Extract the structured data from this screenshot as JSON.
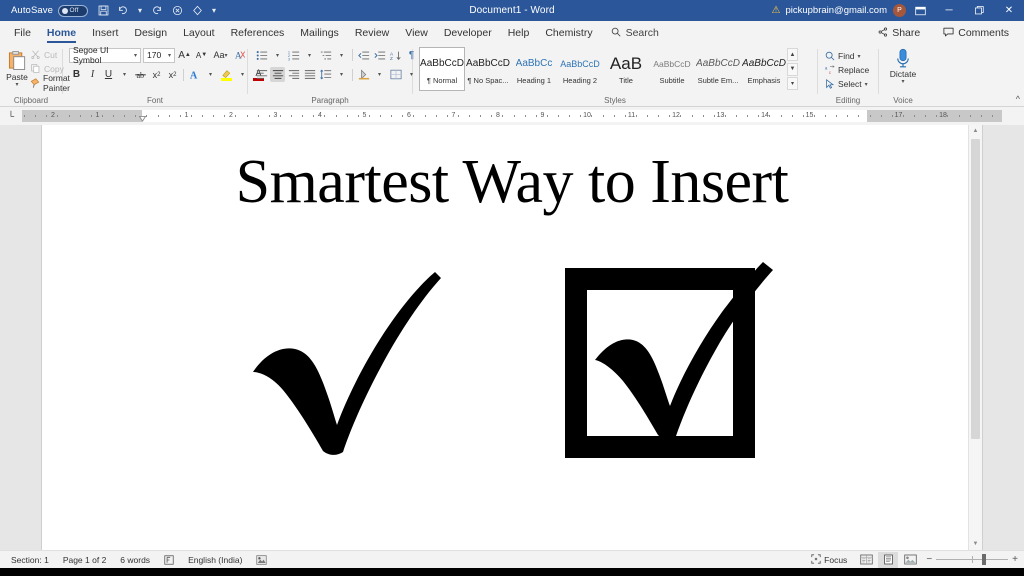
{
  "titlebar": {
    "autosave_label": "AutoSave",
    "autosave_state": "Off",
    "document_title": "Document1  -  Word",
    "account_email": "pickupbrain@gmail.com",
    "avatar_initial": "P",
    "quick_access": [
      {
        "name": "save-icon",
        "glyph": "⬒"
      },
      {
        "name": "undo-icon",
        "glyph": "↶"
      },
      {
        "name": "undo-dropdown-icon",
        "glyph": "⌄"
      },
      {
        "name": "redo-icon",
        "glyph": "↻"
      },
      {
        "name": "cancel-icon",
        "glyph": "⊗"
      },
      {
        "name": "touch-mode-icon",
        "glyph": "◇"
      },
      {
        "name": "customize-qat-icon",
        "glyph": "⌄"
      }
    ],
    "window_controls": {
      "ribbon_display": "❑",
      "minimize": "─",
      "restore": "❐",
      "close": "✕"
    },
    "warning_icon": "⚠",
    "colors": {
      "titlebar_bg": "#2b579a",
      "accent": "#2b579a",
      "avatar_bg": "#a4573b",
      "warning": "#ffc83d"
    }
  },
  "tabs": [
    {
      "label": "File",
      "active": false
    },
    {
      "label": "Home",
      "active": true
    },
    {
      "label": "Insert",
      "active": false
    },
    {
      "label": "Design",
      "active": false
    },
    {
      "label": "Layout",
      "active": false
    },
    {
      "label": "References",
      "active": false
    },
    {
      "label": "Mailings",
      "active": false
    },
    {
      "label": "Review",
      "active": false
    },
    {
      "label": "View",
      "active": false
    },
    {
      "label": "Developer",
      "active": false
    },
    {
      "label": "Help",
      "active": false
    },
    {
      "label": "Chemistry",
      "active": false
    }
  ],
  "search": {
    "placeholder": "Search",
    "value": "Search"
  },
  "tabsright": {
    "share_label": "Share",
    "comments_label": "Comments"
  },
  "ribbon": {
    "clipboard": {
      "group_label": "Clipboard",
      "paste_label": "Paste",
      "items": [
        {
          "label": "Cut",
          "icon": "scissors-icon",
          "enabled": false
        },
        {
          "label": "Copy",
          "icon": "copy-icon",
          "enabled": false
        },
        {
          "label": "Format Painter",
          "icon": "format-painter-icon",
          "enabled": true
        }
      ]
    },
    "font": {
      "group_label": "Font",
      "font_name": "Segoe UI Symbol",
      "font_size": "170",
      "buttons_row1": [
        "grow-font-icon",
        "shrink-font-icon",
        "change-case-icon",
        "clear-formatting-icon"
      ],
      "buttons_row2": [
        "bold-button",
        "italic-button",
        "underline-button",
        "strikethrough-button",
        "subscript-button",
        "superscript-button",
        "text-effects-button",
        "text-highlight-button",
        "font-color-button"
      ]
    },
    "paragraph": {
      "group_label": "Paragraph",
      "alignment_active": "center",
      "buttons_row1": [
        "bullets-icon",
        "numbering-icon",
        "multilevel-list-icon",
        "decrease-indent-icon",
        "increase-indent-icon",
        "sort-icon",
        "show-marks-icon"
      ],
      "buttons_row2": [
        "align-left-icon",
        "align-center-icon",
        "align-right-icon",
        "justify-icon",
        "line-spacing-icon",
        "shading-icon",
        "borders-icon"
      ]
    },
    "styles": {
      "group_label": "Styles",
      "items": [
        {
          "preview": "AaBbCcD",
          "name": "¶ Normal",
          "selected": true
        },
        {
          "preview": "AaBbCcD",
          "name": "¶ No Spac...",
          "selected": false
        },
        {
          "preview": "AaBbCc",
          "name": "Heading 1",
          "selected": false
        },
        {
          "preview": "AaBbCcD",
          "name": "Heading 2",
          "selected": false
        },
        {
          "preview": "AaB",
          "name": "Title",
          "selected": false
        },
        {
          "preview": "AaBbCcD",
          "name": "Subtitle",
          "selected": false
        },
        {
          "preview": "AaBbCcD",
          "name": "Subtle Em...",
          "selected": false
        },
        {
          "preview": "AaBbCcD",
          "name": "Emphasis",
          "selected": false
        }
      ]
    },
    "editing": {
      "group_label": "Editing",
      "items": [
        {
          "label": "Find",
          "icon": "find-icon"
        },
        {
          "label": "Replace",
          "icon": "replace-icon"
        },
        {
          "label": "Select",
          "icon": "select-icon"
        }
      ]
    },
    "voice": {
      "group_label": "Voice",
      "dictate_label": "Dictate",
      "icon": "microphone-icon"
    },
    "collapse_icon": "chevron-up-icon"
  },
  "ruler": {
    "tabstop_glyph": "└",
    "left_labels": [
      "2",
      "1"
    ],
    "right_labels": [
      "1",
      "2",
      "3",
      "4",
      "5",
      "6",
      "7",
      "8",
      "9",
      "10",
      "11",
      "12",
      "13",
      "14",
      "15"
    ],
    "gray_right_labels": [
      "17",
      "18"
    ]
  },
  "document": {
    "heading": "Smartest Way to Insert",
    "marks": [
      {
        "name": "heavy-check-mark",
        "glyph": "✔"
      },
      {
        "name": "ballot-box-with-check",
        "glyph": "☑"
      }
    ]
  },
  "statusbar": {
    "section": "Section: 1",
    "page": "Page 1 of 2",
    "words": "6 words",
    "proofing_icon": "proofing-errors-icon",
    "language": "English (India)",
    "accessibility_icon": "accessibility-icon",
    "focus_label": "Focus",
    "views": [
      {
        "name": "read-mode-view",
        "active": false
      },
      {
        "name": "print-layout-view",
        "active": true
      },
      {
        "name": "web-layout-view",
        "active": false
      }
    ],
    "zoom_out": "−",
    "zoom_in": "+"
  }
}
